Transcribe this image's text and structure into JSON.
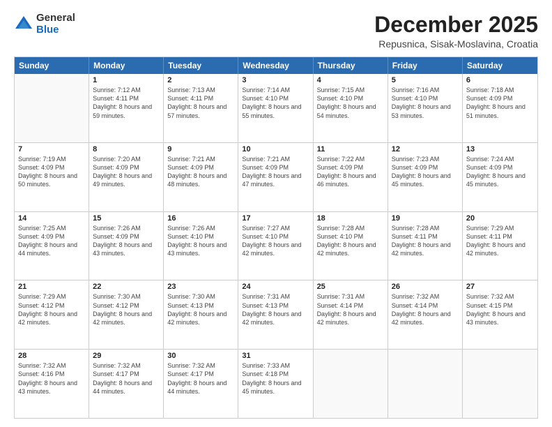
{
  "logo": {
    "general": "General",
    "blue": "Blue"
  },
  "title": "December 2025",
  "subtitle": "Repusnica, Sisak-Moslavina, Croatia",
  "days_of_week": [
    "Sunday",
    "Monday",
    "Tuesday",
    "Wednesday",
    "Thursday",
    "Friday",
    "Saturday"
  ],
  "weeks": [
    [
      {
        "day": "",
        "empty": true
      },
      {
        "day": "1",
        "sunrise": "7:12 AM",
        "sunset": "4:11 PM",
        "daylight": "8 hours and 59 minutes."
      },
      {
        "day": "2",
        "sunrise": "7:13 AM",
        "sunset": "4:11 PM",
        "daylight": "8 hours and 57 minutes."
      },
      {
        "day": "3",
        "sunrise": "7:14 AM",
        "sunset": "4:10 PM",
        "daylight": "8 hours and 55 minutes."
      },
      {
        "day": "4",
        "sunrise": "7:15 AM",
        "sunset": "4:10 PM",
        "daylight": "8 hours and 54 minutes."
      },
      {
        "day": "5",
        "sunrise": "7:16 AM",
        "sunset": "4:10 PM",
        "daylight": "8 hours and 53 minutes."
      },
      {
        "day": "6",
        "sunrise": "7:18 AM",
        "sunset": "4:09 PM",
        "daylight": "8 hours and 51 minutes."
      }
    ],
    [
      {
        "day": "7",
        "sunrise": "7:19 AM",
        "sunset": "4:09 PM",
        "daylight": "8 hours and 50 minutes."
      },
      {
        "day": "8",
        "sunrise": "7:20 AM",
        "sunset": "4:09 PM",
        "daylight": "8 hours and 49 minutes."
      },
      {
        "day": "9",
        "sunrise": "7:21 AM",
        "sunset": "4:09 PM",
        "daylight": "8 hours and 48 minutes."
      },
      {
        "day": "10",
        "sunrise": "7:21 AM",
        "sunset": "4:09 PM",
        "daylight": "8 hours and 47 minutes."
      },
      {
        "day": "11",
        "sunrise": "7:22 AM",
        "sunset": "4:09 PM",
        "daylight": "8 hours and 46 minutes."
      },
      {
        "day": "12",
        "sunrise": "7:23 AM",
        "sunset": "4:09 PM",
        "daylight": "8 hours and 45 minutes."
      },
      {
        "day": "13",
        "sunrise": "7:24 AM",
        "sunset": "4:09 PM",
        "daylight": "8 hours and 45 minutes."
      }
    ],
    [
      {
        "day": "14",
        "sunrise": "7:25 AM",
        "sunset": "4:09 PM",
        "daylight": "8 hours and 44 minutes."
      },
      {
        "day": "15",
        "sunrise": "7:26 AM",
        "sunset": "4:09 PM",
        "daylight": "8 hours and 43 minutes."
      },
      {
        "day": "16",
        "sunrise": "7:26 AM",
        "sunset": "4:10 PM",
        "daylight": "8 hours and 43 minutes."
      },
      {
        "day": "17",
        "sunrise": "7:27 AM",
        "sunset": "4:10 PM",
        "daylight": "8 hours and 42 minutes."
      },
      {
        "day": "18",
        "sunrise": "7:28 AM",
        "sunset": "4:10 PM",
        "daylight": "8 hours and 42 minutes."
      },
      {
        "day": "19",
        "sunrise": "7:28 AM",
        "sunset": "4:11 PM",
        "daylight": "8 hours and 42 minutes."
      },
      {
        "day": "20",
        "sunrise": "7:29 AM",
        "sunset": "4:11 PM",
        "daylight": "8 hours and 42 minutes."
      }
    ],
    [
      {
        "day": "21",
        "sunrise": "7:29 AM",
        "sunset": "4:12 PM",
        "daylight": "8 hours and 42 minutes."
      },
      {
        "day": "22",
        "sunrise": "7:30 AM",
        "sunset": "4:12 PM",
        "daylight": "8 hours and 42 minutes."
      },
      {
        "day": "23",
        "sunrise": "7:30 AM",
        "sunset": "4:13 PM",
        "daylight": "8 hours and 42 minutes."
      },
      {
        "day": "24",
        "sunrise": "7:31 AM",
        "sunset": "4:13 PM",
        "daylight": "8 hours and 42 minutes."
      },
      {
        "day": "25",
        "sunrise": "7:31 AM",
        "sunset": "4:14 PM",
        "daylight": "8 hours and 42 minutes."
      },
      {
        "day": "26",
        "sunrise": "7:32 AM",
        "sunset": "4:14 PM",
        "daylight": "8 hours and 42 minutes."
      },
      {
        "day": "27",
        "sunrise": "7:32 AM",
        "sunset": "4:15 PM",
        "daylight": "8 hours and 43 minutes."
      }
    ],
    [
      {
        "day": "28",
        "sunrise": "7:32 AM",
        "sunset": "4:16 PM",
        "daylight": "8 hours and 43 minutes."
      },
      {
        "day": "29",
        "sunrise": "7:32 AM",
        "sunset": "4:17 PM",
        "daylight": "8 hours and 44 minutes."
      },
      {
        "day": "30",
        "sunrise": "7:32 AM",
        "sunset": "4:17 PM",
        "daylight": "8 hours and 44 minutes."
      },
      {
        "day": "31",
        "sunrise": "7:33 AM",
        "sunset": "4:18 PM",
        "daylight": "8 hours and 45 minutes."
      },
      {
        "day": "",
        "empty": true
      },
      {
        "day": "",
        "empty": true
      },
      {
        "day": "",
        "empty": true
      }
    ]
  ]
}
